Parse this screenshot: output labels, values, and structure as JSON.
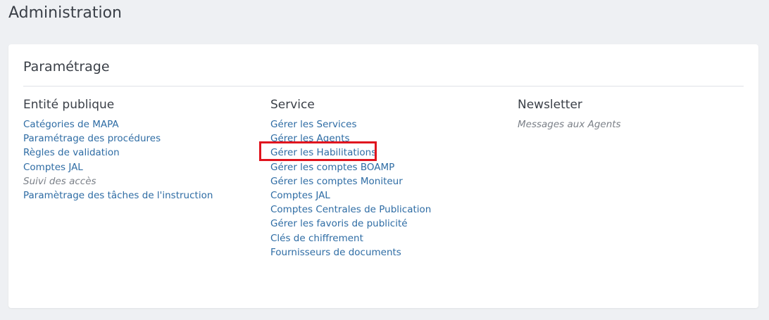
{
  "page": {
    "title": "Administration"
  },
  "card": {
    "title": "Paramétrage",
    "columns": [
      {
        "title": "Entité publique",
        "items": [
          {
            "label": "Catégories de MAPA",
            "enabled": true
          },
          {
            "label": "Paramétrage des procédures",
            "enabled": true
          },
          {
            "label": "Règles de validation",
            "enabled": true
          },
          {
            "label": "Comptes JAL",
            "enabled": true
          },
          {
            "label": "Suivi des accès",
            "enabled": false
          },
          {
            "label": "Paramètrage des tâches de l'instruction",
            "enabled": true
          }
        ]
      },
      {
        "title": "Service",
        "items": [
          {
            "label": "Gérer les Services",
            "enabled": true
          },
          {
            "label": "Gérer les Agents",
            "enabled": true
          },
          {
            "label": "Gérer les Habilitations",
            "enabled": true,
            "highlighted": true
          },
          {
            "label": "Gérer les comptes BOAMP",
            "enabled": true
          },
          {
            "label": "Gérer les comptes Moniteur",
            "enabled": true
          },
          {
            "label": "Comptes JAL",
            "enabled": true
          },
          {
            "label": "Comptes Centrales de Publication",
            "enabled": true
          },
          {
            "label": "Gérer les favoris de publicité",
            "enabled": true
          },
          {
            "label": "Clés de chiffrement",
            "enabled": true
          },
          {
            "label": "Fournisseurs de documents",
            "enabled": true
          }
        ]
      },
      {
        "title": "Newsletter",
        "items": [
          {
            "label": "Messages aux Agents",
            "enabled": false
          }
        ]
      }
    ]
  },
  "colors": {
    "link": "#2e6ca4",
    "muted": "#7b8088",
    "highlight": "#e0141e",
    "background": "#eef0f3"
  }
}
